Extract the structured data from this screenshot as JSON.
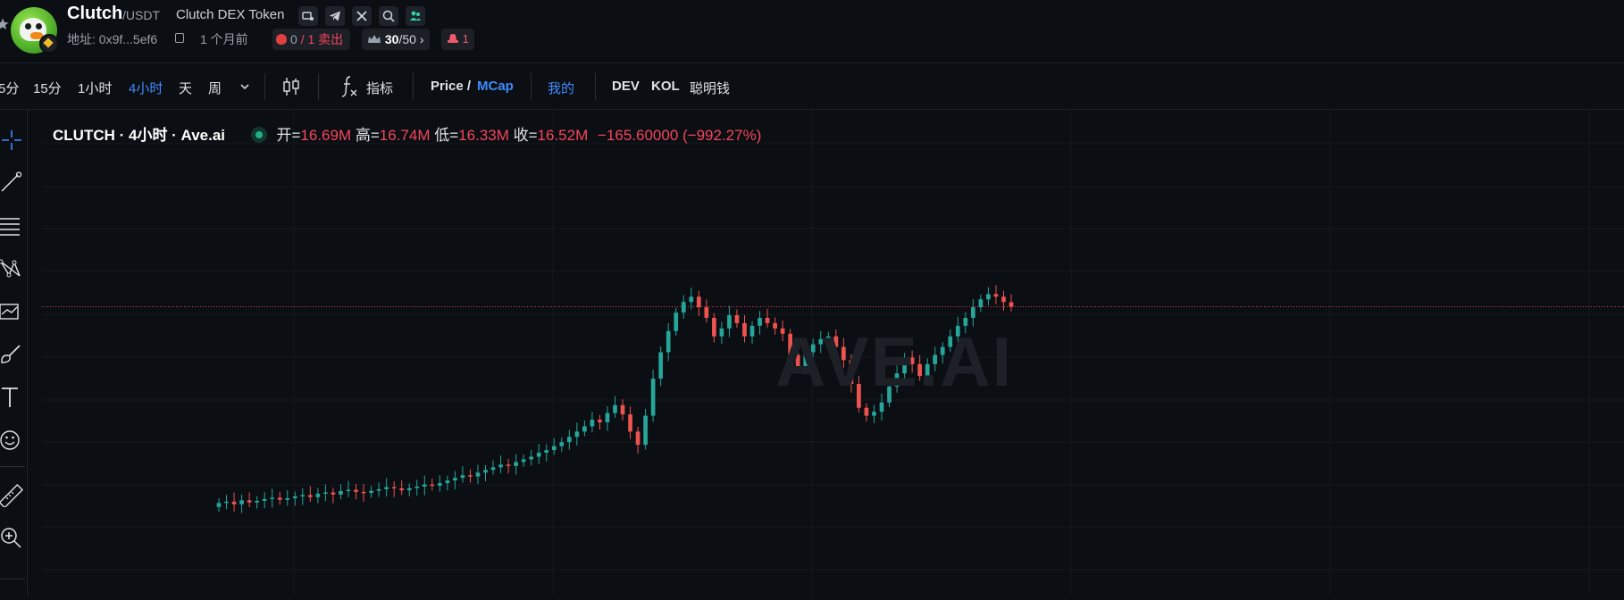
{
  "header": {
    "token_name": "Clutch",
    "pair": "/USDT",
    "full_name": "Clutch DEX Token",
    "social_icons": [
      "website-icon",
      "telegram-icon",
      "x-icon",
      "search-icon",
      "community-icon"
    ],
    "address": "地址: 0x9f...5ef6",
    "age": "1 个月前",
    "sell_count": "0",
    "sell_text": "/ 1 卖出",
    "holders_current": "30",
    "holders_total": "/50",
    "hat_count": "1"
  },
  "toolbar": {
    "intervals": [
      "5分",
      "15分",
      "1小时",
      "4小时",
      "天",
      "周"
    ],
    "active_interval": "4小时",
    "indicator_label": "指标",
    "price_label": "Price /",
    "mcap_label": "MCap",
    "mine_label": "我的",
    "dev_label": "DEV",
    "kol_label": "KOL",
    "smart_label": "聪明钱"
  },
  "sidebar": {
    "tools": [
      "crosshair-icon",
      "trendline-icon",
      "fib-lines-icon",
      "pattern-icon",
      "forecast-icon",
      "brush-icon",
      "text-icon",
      "emoji-icon",
      "ruler-icon",
      "zoom-in-icon"
    ]
  },
  "legend": {
    "symbol": "CLUTCH · 4小时 · Ave.ai",
    "open_label": "开=",
    "open": "16.69M",
    "high_label": "高=",
    "high": "16.74M",
    "low_label": "低=",
    "low": "16.33M",
    "close_label": "收=",
    "close": "16.52M",
    "change": "−165.60000 (−992.27%)"
  },
  "watermark": "AVE.AI",
  "colors": {
    "up": "#26a69a",
    "down": "#ef5350",
    "accent": "#3f8cff",
    "background": "#0b0e12"
  },
  "chart_data": {
    "type": "candlestick",
    "title": "CLUTCH · 4小时 · Ave.ai",
    "y_unit": "market cap",
    "ylim": [
      5.6,
      24.0
    ],
    "series": [
      {
        "name": "CLUTCH",
        "close": [
          9.1,
          9.15,
          9.05,
          9.2,
          9.12,
          9.18,
          9.25,
          9.3,
          9.22,
          9.28,
          9.35,
          9.4,
          9.32,
          9.45,
          9.5,
          9.42,
          9.55,
          9.6,
          9.52,
          9.48,
          9.56,
          9.62,
          9.7,
          9.65,
          9.58,
          9.66,
          9.72,
          9.8,
          9.75,
          9.85,
          9.95,
          10.05,
          10.15,
          10.1,
          10.25,
          10.35,
          10.45,
          10.55,
          10.5,
          10.65,
          10.75,
          10.85,
          11.0,
          11.1,
          11.25,
          11.4,
          11.6,
          11.8,
          12.0,
          12.25,
          12.15,
          12.5,
          12.8,
          12.45,
          11.8,
          11.3,
          12.4,
          13.8,
          14.8,
          15.6,
          16.3,
          16.7,
          16.9,
          16.5,
          16.1,
          15.4,
          15.7,
          16.2,
          15.9,
          15.4,
          15.8,
          16.1,
          15.9,
          15.7,
          15.5,
          14.7,
          14.2,
          14.8,
          15.1,
          15.3,
          15.4,
          15.0,
          14.5,
          13.6,
          12.7,
          12.4,
          12.55,
          12.9,
          13.5,
          14.0,
          14.6,
          14.35,
          13.9,
          14.35,
          14.7,
          15.0,
          15.4,
          15.8,
          16.1,
          16.5,
          16.8,
          17.0,
          16.9,
          16.7,
          16.52
        ],
        "open_last": 16.69,
        "high_last": 16.74,
        "low_last": 16.33
      }
    ]
  }
}
